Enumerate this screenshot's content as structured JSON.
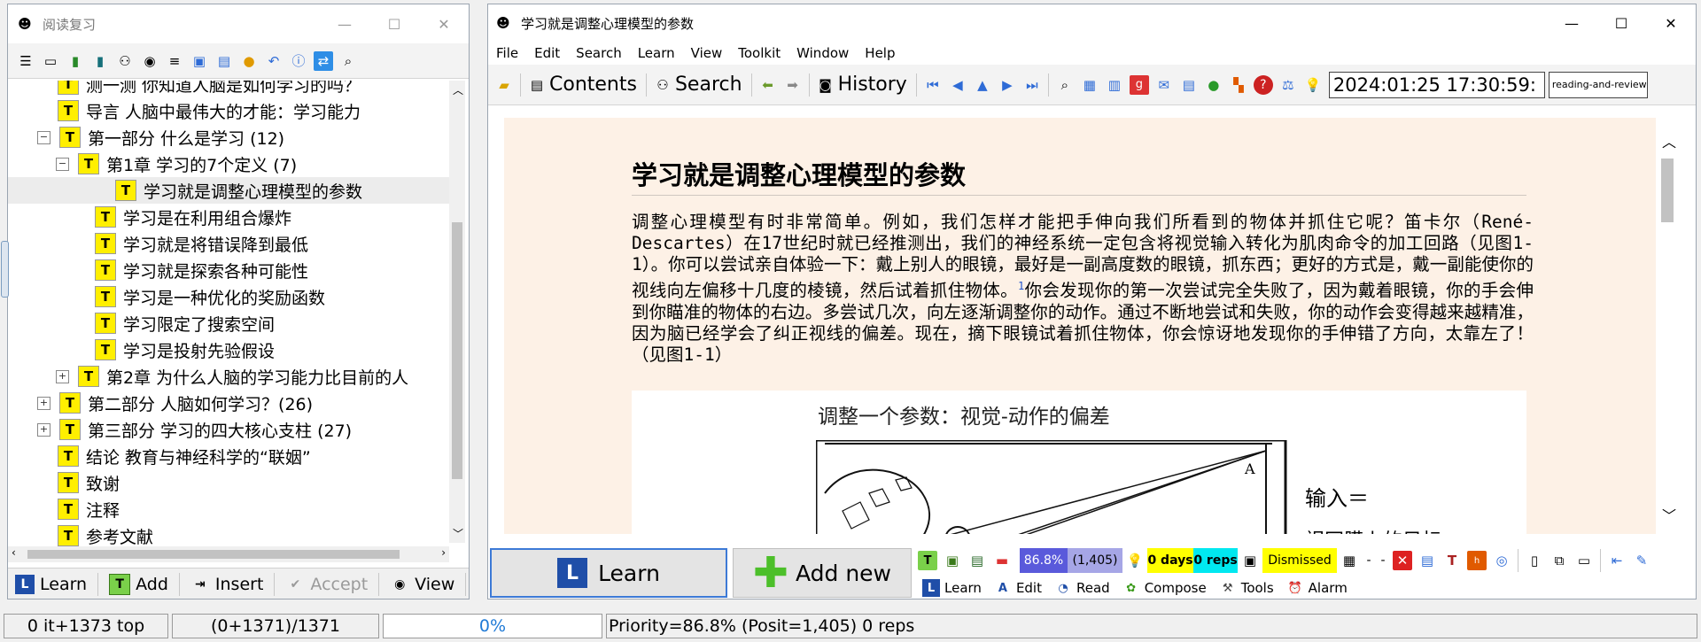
{
  "left_window": {
    "title": "阅读复习",
    "tree": [
      {
        "label": "测一测    你知道人脑是如何学习的吗？",
        "level": 1,
        "expander": ""
      },
      {
        "label": "导言    人脑中最伟大的才能：学习能力",
        "level": 1,
        "expander": ""
      },
      {
        "label": "第一部分    什么是学习 (12)",
        "level": 1,
        "expander": "−"
      },
      {
        "label": "第1章    学习的7个定义 (7)",
        "level": 2,
        "expander": "−"
      },
      {
        "label": "学习就是调整心理模型的参数",
        "level": 3,
        "expander": "",
        "selected": true
      },
      {
        "label": "学习是在利用组合爆炸",
        "level": 3,
        "expander": ""
      },
      {
        "label": "学习就是将错误降到最低",
        "level": 3,
        "expander": ""
      },
      {
        "label": "学习就是探索各种可能性",
        "level": 3,
        "expander": ""
      },
      {
        "label": "学习是一种优化的奖励函数",
        "level": 3,
        "expander": ""
      },
      {
        "label": "学习限定了搜索空间",
        "level": 3,
        "expander": ""
      },
      {
        "label": "学习是投射先验假设",
        "level": 3,
        "expander": ""
      },
      {
        "label": "第2章    为什么人脑的学习能力比目前的人",
        "level": 2,
        "expander": "+"
      },
      {
        "label": "第二部分    人脑如何学习？(26)",
        "level": 1,
        "expander": "+"
      },
      {
        "label": "第三部分    学习的四大核心支柱 (27)",
        "level": 1,
        "expander": "+"
      },
      {
        "label": "结论    教育与神经科学的“联姻”",
        "level": 1,
        "expander": ""
      },
      {
        "label": "致谢",
        "level": 1,
        "expander": ""
      },
      {
        "label": "注释",
        "level": 1,
        "expander": ""
      },
      {
        "label": "参考文献",
        "level": 1,
        "expander": ""
      }
    ],
    "bottom_buttons": {
      "learn": "Learn",
      "add": "Add",
      "insert": "Insert",
      "accept": "Accept",
      "view": "View"
    }
  },
  "main_window": {
    "title": "学习就是调整心理模型的参数",
    "menu": [
      "File",
      "Edit",
      "Search",
      "Learn",
      "View",
      "Toolkit",
      "Window",
      "Help"
    ],
    "toolbar": {
      "contents": "Contents",
      "search": "Search",
      "history": "History",
      "datetime": "2024:01:25 17:30:59:",
      "field2": "reading-and-review (S"
    },
    "article": {
      "title": "学习就是调整心理模型的参数",
      "body_before": "调整心理模型有时非常简单。例如，我们怎样才能把手伸向我们所看到的物体并抓住它呢？笛卡尔（René-Descartes）在17世纪时就已经推测出，我们的神经系统一定包含将视觉输入转化为肌肉命令的加工回路（见图1-1）。你可以尝试亲自体验一下：戴上别人的眼镜，最好是一副高度数的眼镜，抓东西；更好的方式是，戴一副能使你的视线向左偏移十几度的棱镜，然后试着抓住物体。",
      "footnote": "1",
      "body_after": "你会发现你的第一次尝试完全失败了，因为戴着眼镜，你的手会伸到你瞄准的物体的右边。多尝试几次，向左逐渐调整你的动作。通过不断地尝试和失败，你的动作会变得越来越精准，因为脑已经学会了纠正视线的偏差。现在，摘下眼镜试着抓住物体，你会惊讶地发现你的手伸错了方向，太靠左了！（见图1-1）",
      "figure_caption": "调整一个参数：视觉-动作的偏差",
      "figure_input": "输入＝",
      "figure_sub": "视网膜上的目标"
    },
    "learn_button": "Learn",
    "add_new_button": "Add new",
    "stats": {
      "priority_pct": "86.8%",
      "position": "(1,405)",
      "days": "0 days",
      "reps": "0 reps",
      "dismissed": "Dismissed",
      "dash1": "-",
      "dash2": "-"
    },
    "tabs": [
      "Learn",
      "Edit",
      "Read",
      "Compose",
      "Tools",
      "Alarm"
    ]
  },
  "statusbar": {
    "items": "0 it+1373 top",
    "counts": "(0+1371)/1371",
    "progress": "0%",
    "priority": "Priority=86.8% (Posit=1,405) 0 reps"
  },
  "colors": {
    "content_bg": "#fdf1e6",
    "accent_blue": "#2e6bd6",
    "tree_icon": "#ffef00"
  }
}
